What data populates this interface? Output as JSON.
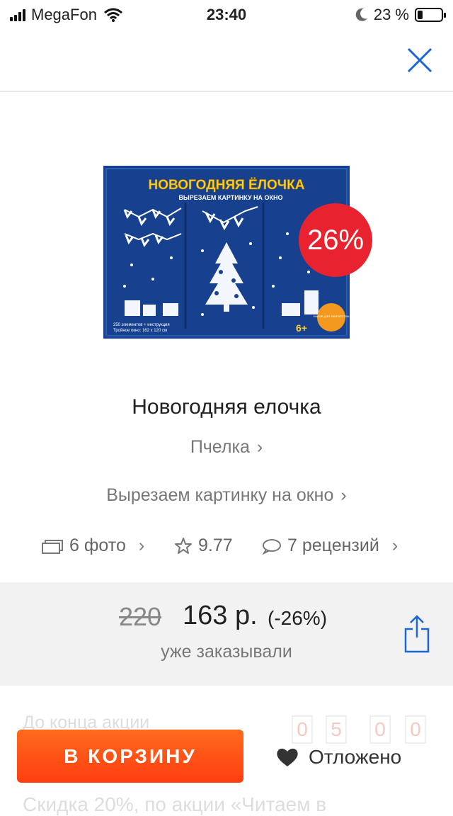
{
  "status_bar": {
    "carrier": "MegaFon",
    "time": "23:40",
    "battery_percent": "23 %",
    "battery_level": 0.23,
    "icons": [
      "signal-icon",
      "wifi-icon",
      "moon-icon",
      "battery-icon"
    ]
  },
  "header": {
    "close_icon": "close-icon",
    "accent": "#1a66d6"
  },
  "product": {
    "discount_badge": "26%",
    "badge_color": "#e8232f",
    "title": "Новогодняя елочка",
    "publisher": "Пчелка",
    "series": "Вырезаем картинку на окно",
    "chevron": "›",
    "image_text": {
      "headline": "НОВОГОДНЯЯ ЁЛОЧКА",
      "subline": "ВЫРЕЗАЕМ КАРТИНКУ НА ОКНО",
      "info1": "250 элементов + инструкция",
      "info2": "Тройное окно: 162 x 120 см",
      "age": "6+",
      "seal": "НАБОР ДЛЯ ТВОРЧЕСТВА"
    }
  },
  "meta": {
    "photos": "6 фото",
    "rating": "9.77",
    "reviews": "7 рецензий"
  },
  "pricing": {
    "old_price": "220",
    "new_price": "163 р.",
    "discount": "(-26%)",
    "ordered_note": "уже заказывали"
  },
  "promo": {
    "countdown_label": "До конца акции",
    "countdown_digits": [
      "0",
      "5",
      "0",
      "0"
    ],
    "discount_text": "Скидка 20%, по акции «Читаем в"
  },
  "actions": {
    "cart_label": "В КОРЗИНУ",
    "saved_label": "Отложено",
    "cart_color": "#ff4f14"
  }
}
